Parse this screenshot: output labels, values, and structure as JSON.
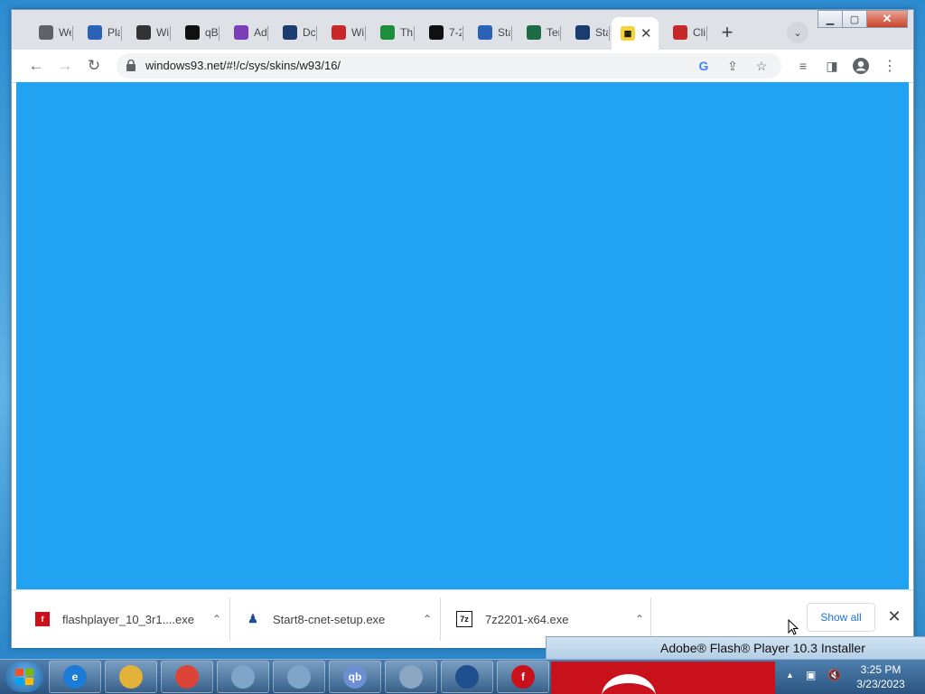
{
  "browser": {
    "tabs": [
      {
        "label": "We",
        "favicon": "globe-icon",
        "color": "#5f6368"
      },
      {
        "label": "Pla",
        "favicon": "penguin-icon",
        "color": "#2a62b8"
      },
      {
        "label": "Wi",
        "favicon": "ghost-icon",
        "color": "#333333"
      },
      {
        "label": "qB",
        "favicon": "ring-icon",
        "color": "#111111"
      },
      {
        "label": "Ad",
        "favicon": "gear-color-icon",
        "color": "#7a3fb8"
      },
      {
        "label": "Dc",
        "favicon": "steam-icon",
        "color": "#1a3c6e"
      },
      {
        "label": "Wi",
        "favicon": "card-icon",
        "color": "#c62828"
      },
      {
        "label": "Th",
        "favicon": "check-icon",
        "color": "#1e8e3e"
      },
      {
        "label": "7-2",
        "favicon": "sevenzip-icon",
        "color": "#111111"
      },
      {
        "label": "Sta",
        "favicon": "gear-blue-icon",
        "color": "#2a62b8"
      },
      {
        "label": "Ter",
        "favicon": "terminal-icon",
        "color": "#1e6b45"
      },
      {
        "label": "Sta",
        "favicon": "steam-icon",
        "color": "#1a3c6e"
      },
      {
        "label": "Cli",
        "favicon": "red-figure-icon",
        "color": "#c62828"
      }
    ],
    "active_tab_favicon": "film-icon",
    "address": "windows93.net/#!/c/sys/skins/w93/16/",
    "page_color": "#22a3f1"
  },
  "downloads": {
    "items": [
      {
        "name": "flashplayer_10_3r1....exe",
        "icon": "flash-icon"
      },
      {
        "name": "Start8-cnet-setup.exe",
        "icon": "start8-icon"
      },
      {
        "name": "7z2201-x64.exe",
        "icon": "sevenzip-icon"
      }
    ],
    "show_all": "Show all"
  },
  "flash_installer": {
    "title": "Adobe® Flash® Player 10.3 Installer"
  },
  "taskbar": {
    "apps": [
      {
        "name": "internet-explorer-icon",
        "color": "#1c7bd6",
        "glyph": "e"
      },
      {
        "name": "file-explorer-icon",
        "color": "#e2b23a",
        "glyph": ""
      },
      {
        "name": "chrome-icon",
        "color": "#db4437",
        "glyph": ""
      },
      {
        "name": "setup-disc-icon",
        "color": "#7fa6c9",
        "glyph": ""
      },
      {
        "name": "setup-disc-icon",
        "color": "#7fa6c9",
        "glyph": ""
      },
      {
        "name": "qbittorrent-icon",
        "color": "#6c8fd1",
        "glyph": "qb"
      },
      {
        "name": "task-manager-icon",
        "color": "#8aa7c4",
        "glyph": ""
      },
      {
        "name": "start8-icon",
        "color": "#1f4f8f",
        "glyph": ""
      },
      {
        "name": "flash-icon",
        "color": "#c8111a",
        "glyph": "f"
      }
    ],
    "clock_time": "3:25 PM",
    "clock_date": "3/23/2023"
  }
}
